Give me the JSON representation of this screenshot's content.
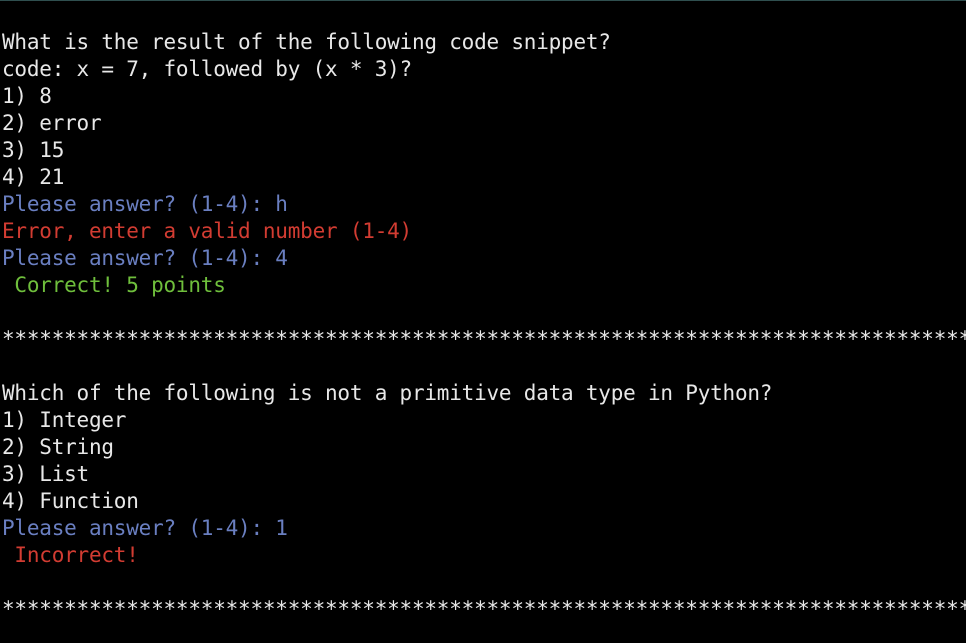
{
  "colors": {
    "background": "#000000",
    "text": "#e8e8e8",
    "prompt": "#6a7fc1",
    "error": "#d23c32",
    "correct": "#6fbf3c"
  },
  "question1": {
    "text": "What is the result of the following code snippet?",
    "code": "code: x = 7, followed by (x * 3)?",
    "options": [
      "1) 8",
      "2) error",
      "3) 15",
      "4) 21"
    ],
    "prompt_1": "Please answer? (1-4): h",
    "error": "Error, enter a valid number (1-4)",
    "prompt_2": "Please answer? (1-4): 4",
    "result": " Correct! 5 points"
  },
  "separator_1": "*************************************************************************************************",
  "question2": {
    "text": "Which of the following is not a primitive data type in Python?",
    "options": [
      "1) Integer",
      "2) String",
      "3) List",
      "4) Function"
    ],
    "prompt": "Please answer? (1-4): 1",
    "result": " Incorrect!"
  },
  "separator_2": "*************************************************************************************************"
}
